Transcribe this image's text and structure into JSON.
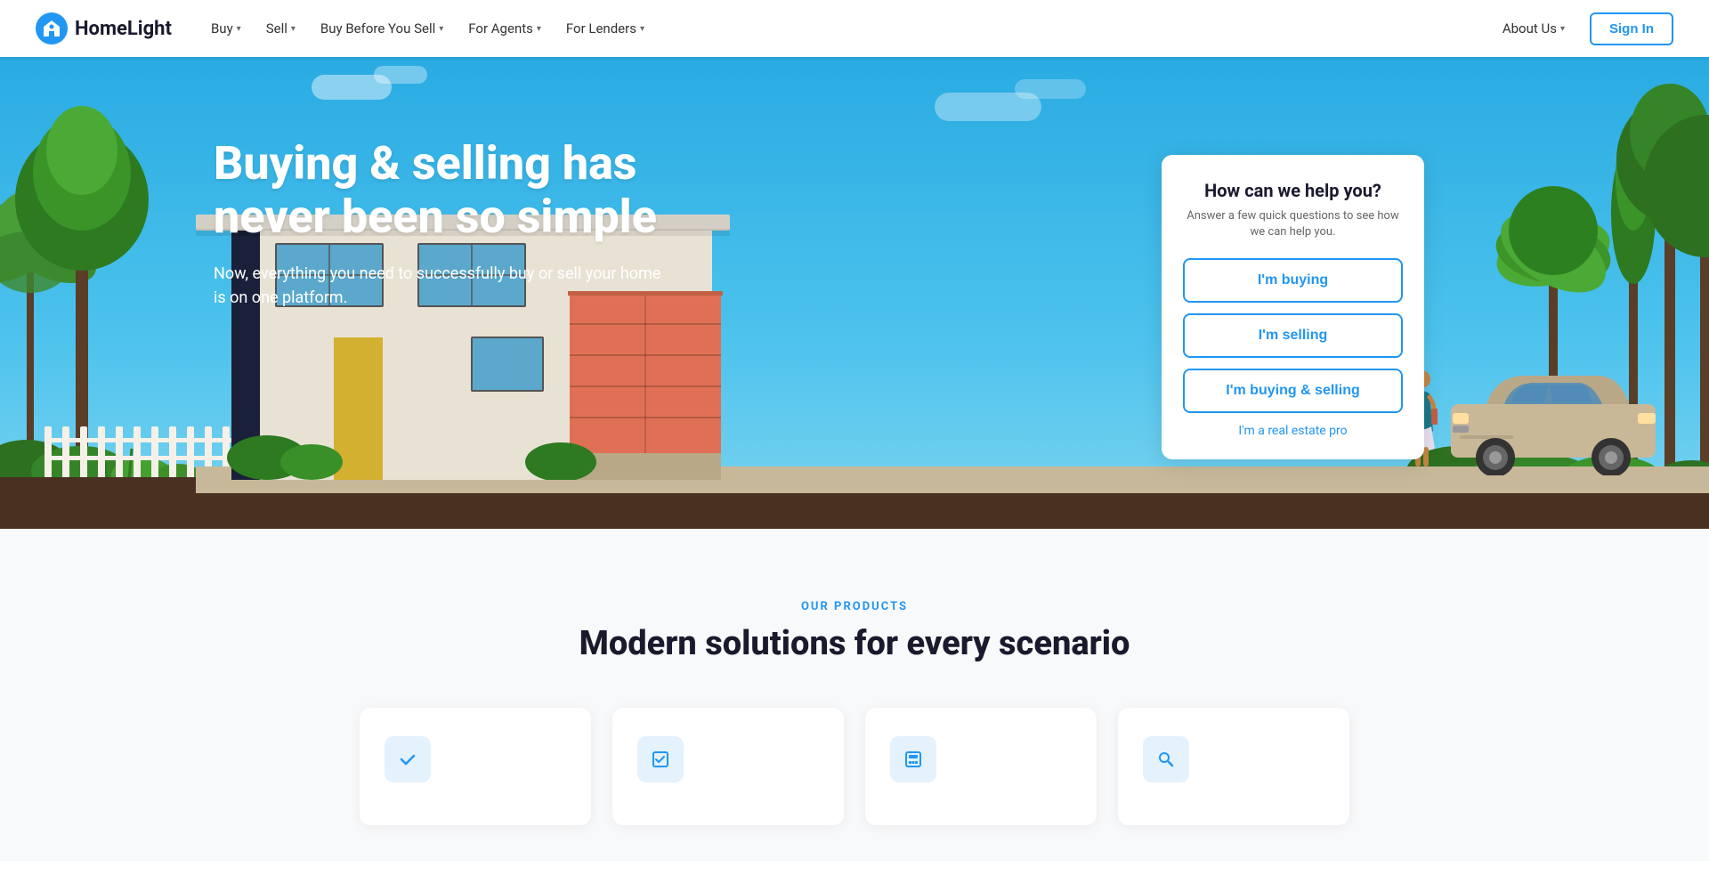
{
  "brand": {
    "name": "HomeLight",
    "logo_color": "#2196F3"
  },
  "navbar": {
    "logo_label": "HomeLight",
    "nav_items": [
      {
        "label": "Buy",
        "has_dropdown": true
      },
      {
        "label": "Sell",
        "has_dropdown": true
      },
      {
        "label": "Buy Before You Sell",
        "has_dropdown": true
      },
      {
        "label": "For Agents",
        "has_dropdown": true
      },
      {
        "label": "For Lenders",
        "has_dropdown": true
      }
    ],
    "about_us_label": "About Us",
    "sign_in_label": "Sign In"
  },
  "hero": {
    "title": "Buying & selling has never been so simple",
    "subtitle": "Now, everything you need to successfully buy or sell your home is on one platform."
  },
  "help_card": {
    "title": "How can we help you?",
    "subtitle": "Answer a few quick questions to see how we can help you.",
    "buttons": [
      {
        "label": "I'm buying"
      },
      {
        "label": "I'm selling"
      },
      {
        "label": "I'm buying & selling"
      }
    ],
    "link_label": "I'm a real estate pro"
  },
  "products_section": {
    "eyebrow": "OUR PRODUCTS",
    "title": "Modern solutions for every scenario",
    "cards": [
      {
        "icon": "checkmark",
        "icon_color": "#2196F3"
      },
      {
        "icon": "list-check",
        "icon_color": "#2196F3"
      },
      {
        "icon": "calculator",
        "icon_color": "#2196F3"
      },
      {
        "icon": "search",
        "icon_color": "#2196F3"
      }
    ]
  }
}
